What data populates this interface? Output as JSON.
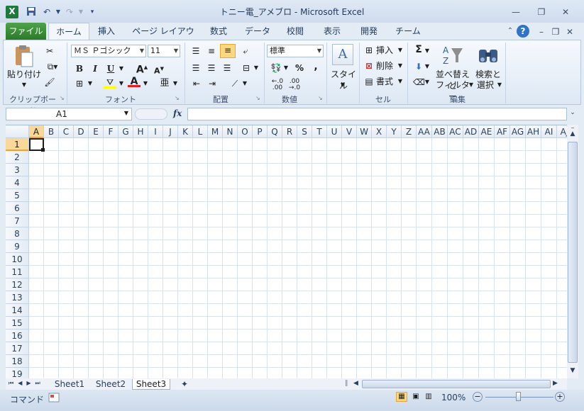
{
  "window": {
    "title": "トニー電_アメブロ - Microsoft Excel",
    "app_icon": "excel-icon"
  },
  "qat": {
    "save_icon": "save-icon",
    "undo_icon": "undo-icon",
    "redo_icon": "redo-icon",
    "customize_icon": "customize-qat-icon"
  },
  "tabs": [
    "ファイル",
    "ホーム",
    "挿入",
    "ページ レイアウト",
    "数式",
    "データ",
    "校閲",
    "表示",
    "開発",
    "チーム"
  ],
  "ribbon": {
    "clipboard": {
      "label": "クリップボード",
      "paste": "貼り付け"
    },
    "font": {
      "label": "フォント",
      "font_name": "ＭＳ Ｐゴシック",
      "font_size": "11",
      "bold": "B",
      "italic": "I",
      "underline": "U"
    },
    "alignment": {
      "label": "配置"
    },
    "number": {
      "label": "数値",
      "format": "標準",
      "percent": "%",
      "comma": ","
    },
    "styles": {
      "label": "スタイル"
    },
    "cells": {
      "label": "セル",
      "insert": "挿入",
      "delete": "削除",
      "format": "書式"
    },
    "editing": {
      "label": "編集",
      "sum": "Σ",
      "sort_filter_1": "並べ替えと",
      "sort_filter_2": "フィルター",
      "find_select_1": "検索と",
      "find_select_2": "選択"
    }
  },
  "formula_bar": {
    "name_box": "A1",
    "fx": "fx",
    "formula": ""
  },
  "grid": {
    "columns": [
      "A",
      "B",
      "C",
      "D",
      "E",
      "F",
      "G",
      "H",
      "I",
      "J",
      "K",
      "L",
      "M",
      "N",
      "O",
      "P",
      "Q",
      "R",
      "S",
      "T",
      "U",
      "V",
      "W",
      "X",
      "Y",
      "Z",
      "AA",
      "AB",
      "AC",
      "AD",
      "AE",
      "AF",
      "AG",
      "AH",
      "AI",
      "AJ"
    ],
    "rows": [
      "1",
      "2",
      "3",
      "4",
      "5",
      "6",
      "7",
      "8",
      "9",
      "10",
      "11",
      "12",
      "13",
      "14",
      "15",
      "16",
      "17",
      "18",
      "19"
    ],
    "active_cell": "A1"
  },
  "sheets": {
    "tabs": [
      "Sheet1",
      "Sheet2",
      "Sheet3"
    ],
    "active": "Sheet3"
  },
  "status": {
    "mode": "コマンド",
    "zoom": "100%"
  }
}
